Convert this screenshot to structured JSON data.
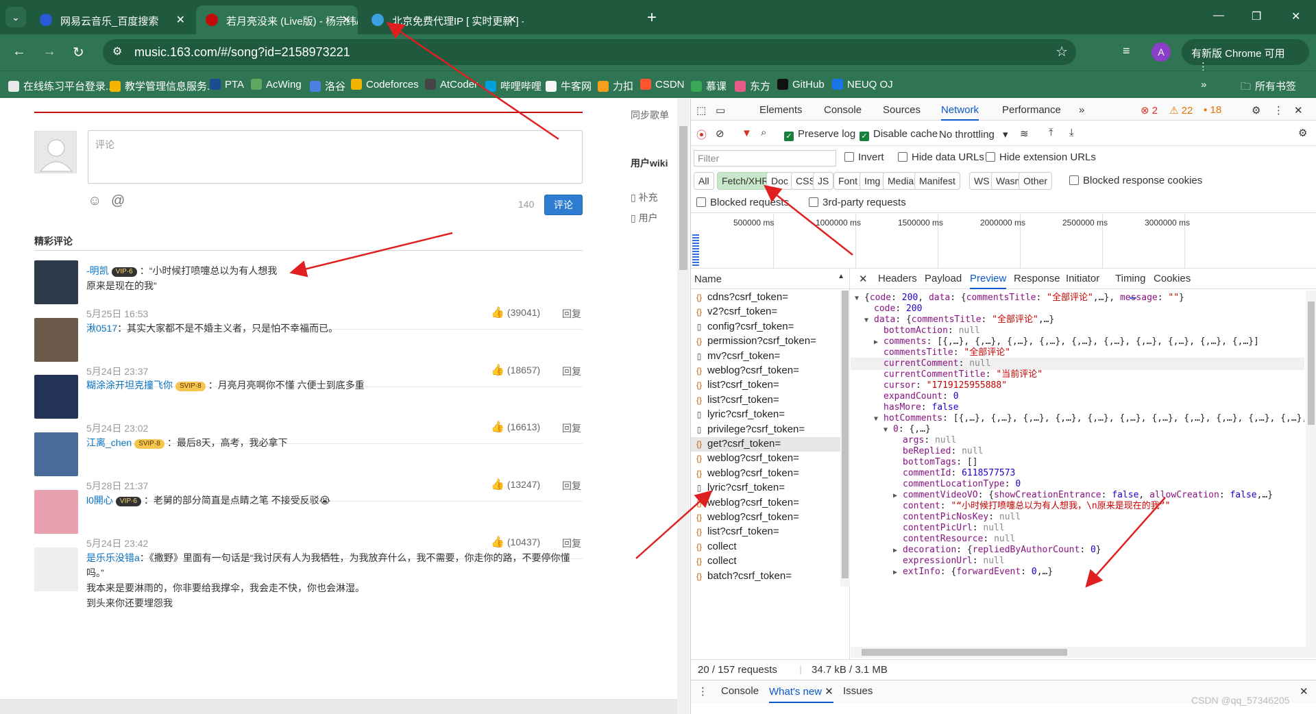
{
  "browser": {
    "tabs": [
      {
        "label": "网易云音乐_百度搜索",
        "fav_color": "#2a5bd7"
      },
      {
        "label": "若月亮没来 (Live版) - 杨宗纬/王…",
        "fav_color": "#c20c0c"
      },
      {
        "label": "北京免费代理IP [ 实时更新 ] - …",
        "fav_color": "#3aa0e0"
      }
    ],
    "url": "music.163.com/#/song?id=2158973221",
    "update_label": "有新版 Chrome 可用",
    "profile_initial": "A",
    "bookmarks": [
      {
        "label": "在线练习平台登录...",
        "color": "#e8e8e8"
      },
      {
        "label": "教学管理信息服务...",
        "color": "#f4b400"
      },
      {
        "label": "PTA",
        "color": "#1a4d8f"
      },
      {
        "label": "AcWing",
        "color": "#5fa85f"
      },
      {
        "label": "洛谷",
        "color": "#4a7fe0"
      },
      {
        "label": "Codeforces",
        "color": "#f0b400"
      },
      {
        "label": "AtCoder",
        "color": "#444"
      },
      {
        "label": "哔哩哔哩",
        "color": "#00a1d6"
      },
      {
        "label": "牛客网",
        "color": "#f5f5f5"
      },
      {
        "label": "力扣",
        "color": "#f89f1b"
      },
      {
        "label": "CSDN",
        "color": "#fc5531"
      },
      {
        "label": "慕课",
        "color": "#3aa757"
      },
      {
        "label": "东方",
        "color": "#e85a87"
      },
      {
        "label": "GitHub",
        "color": "#111"
      },
      {
        "label": "NEUQ OJ",
        "color": "#1a73e8"
      }
    ],
    "bookmarks_more": "»",
    "all_bookmarks": "所有书签"
  },
  "page": {
    "comment_placeholder": "评论",
    "char_count": "140",
    "submit_label": "评论",
    "section_title": "精彩评论",
    "side_sync": "同步歌单",
    "side_wiki": "用户wiki",
    "side_item1": "补充",
    "side_item2": "用户",
    "reply_label": "回复",
    "comments": [
      {
        "user": "-明凯",
        "vip": "VIP·6",
        "vip_type": "dark",
        "text": "：“小时候打喷嚏总以为有人想我",
        "text2": "原来是现在的我”",
        "time": "5月25日 16:53",
        "likes": "(39041)",
        "av": "#2d3a4a"
      },
      {
        "user": "湫0517",
        "vip": "",
        "vip_type": "",
        "text": "：其实大家都不是不婚主义者，只是怕不幸福而已。",
        "text2": "",
        "time": "5月24日 23:37",
        "likes": "(18657)",
        "av": "#6b5a4a"
      },
      {
        "user": "糊涂涂开坦克撞飞你",
        "vip": "SVIP·8",
        "vip_type": "svip",
        "text": "：月亮月亮啊你不懂 六便士到底多重",
        "text2": "",
        "time": "5月24日 23:02",
        "likes": "(16613)",
        "av": "#223355"
      },
      {
        "user": "江离_chen",
        "vip": "SVIP·8",
        "vip_type": "svip",
        "text": "：最后8天，高考，我必拿下",
        "text2": "",
        "time": "5月28日 21:37",
        "likes": "(13247)",
        "av": "#4a6a9a"
      },
      {
        "user": "l0開心",
        "vip": "VIP·6",
        "vip_type": "dark",
        "text": "：老舅的部分简直是点睛之笔 不接受反驳😭",
        "text2": "",
        "time": "5月24日 23:42",
        "likes": "(10437)",
        "av": "#e8a0b0"
      },
      {
        "user": "是乐乐没错a",
        "vip": "",
        "vip_type": "",
        "text": "：《撒野》里面有一句话是“我讨厌有人为我牺牲，为我放弃什么，我不需要，你走你的路，不要停你懂吗。”",
        "text2": "我本来是要淋雨的，你非要给我撑伞，我会走不快，你也会淋湿。",
        "text3": "到头来你还要埋怨我",
        "time": "",
        "likes": "",
        "av": "#eeeeee"
      }
    ]
  },
  "devtools": {
    "tabs": [
      "Elements",
      "Console",
      "Sources",
      "Network",
      "Performance",
      "»"
    ],
    "active_tab": "Network",
    "errors": "2",
    "warnings": "22",
    "issues": "18",
    "preserve_log": "Preserve log",
    "disable_cache": "Disable cache",
    "throttling": "No throttling",
    "filter_placeholder": "Filter",
    "invert": "Invert",
    "hide_data_urls": "Hide data URLs",
    "hide_ext_urls": "Hide extension URLs",
    "type_filters": [
      "All",
      "Fetch/XHR",
      "Doc",
      "CSS",
      "JS",
      "Font",
      "Img",
      "Media",
      "Manifest",
      "WS",
      "Wasm",
      "Other"
    ],
    "active_type": "Fetch/XHR",
    "blocked_response_cookies": "Blocked response cookies",
    "blocked_requests": "Blocked requests",
    "third_party": "3rd-party requests",
    "timeline_labels": [
      "500000 ms",
      "1000000 ms",
      "1500000 ms",
      "2000000 ms",
      "2500000 ms",
      "3000000 ms"
    ],
    "name_header": "Name",
    "requests": [
      {
        "name": "cdns?csrf_token=",
        "type": "xhr"
      },
      {
        "name": "v2?csrf_token=",
        "type": "xhr"
      },
      {
        "name": "config?csrf_token=",
        "type": "doc"
      },
      {
        "name": "permission?csrf_token=",
        "type": "xhr"
      },
      {
        "name": "mv?csrf_token=",
        "type": "doc"
      },
      {
        "name": "weblog?csrf_token=",
        "type": "xhr"
      },
      {
        "name": "list?csrf_token=",
        "type": "xhr"
      },
      {
        "name": "list?csrf_token=",
        "type": "xhr"
      },
      {
        "name": "lyric?csrf_token=",
        "type": "doc"
      },
      {
        "name": "privilege?csrf_token=",
        "type": "doc"
      },
      {
        "name": "get?csrf_token=",
        "type": "xhr",
        "selected": true
      },
      {
        "name": "weblog?csrf_token=",
        "type": "xhr"
      },
      {
        "name": "weblog?csrf_token=",
        "type": "xhr"
      },
      {
        "name": "lyric?csrf_token=",
        "type": "doc"
      },
      {
        "name": "weblog?csrf_token=",
        "type": "xhr"
      },
      {
        "name": "weblog?csrf_token=",
        "type": "xhr"
      },
      {
        "name": "list?csrf_token=",
        "type": "xhr"
      },
      {
        "name": "collect",
        "type": "xhr"
      },
      {
        "name": "collect",
        "type": "xhr"
      },
      {
        "name": "batch?csrf_token=",
        "type": "xhr"
      }
    ],
    "status_requests": "20 / 157 requests",
    "status_size": "34.7 kB / 3.1 MB",
    "detail_tabs": [
      "Headers",
      "Payload",
      "Preview",
      "Response",
      "Initiator",
      "Timing",
      "Cookies"
    ],
    "active_detail_tab": "Preview",
    "drawer_tabs": [
      "Console",
      "What's new",
      "Issues"
    ],
    "active_drawer_tab": "What's new"
  },
  "watermark": "CSDN @qq_57346205"
}
